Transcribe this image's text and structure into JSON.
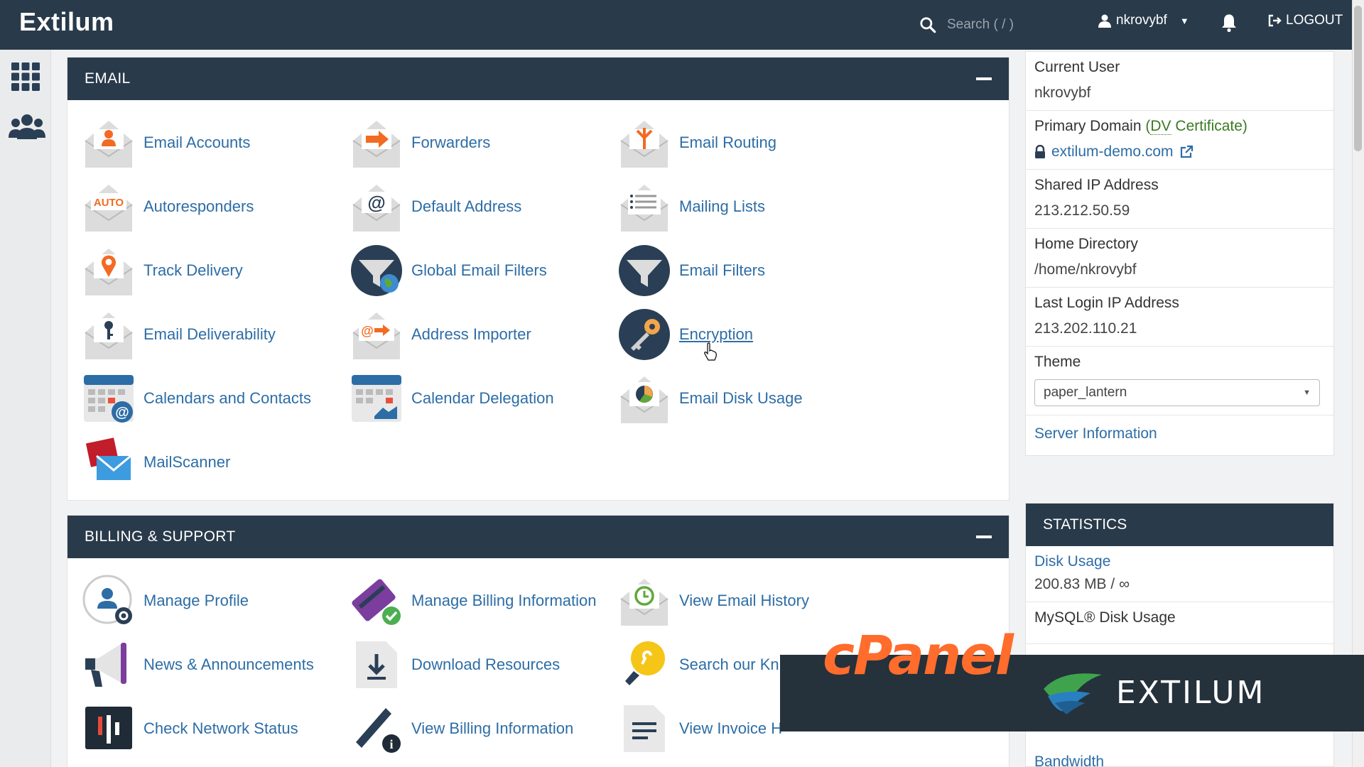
{
  "header": {
    "brand": "Extilum",
    "search_placeholder": "Search ( / )",
    "username": "nkrovybf",
    "logout_label": "LOGOUT"
  },
  "email_panel": {
    "title": "EMAIL",
    "items": [
      {
        "label": "Email Accounts",
        "icon": "email-accounts-icon"
      },
      {
        "label": "Forwarders",
        "icon": "forwarders-icon"
      },
      {
        "label": "Email Routing",
        "icon": "email-routing-icon"
      },
      {
        "label": "Autoresponders",
        "icon": "autoresponders-icon"
      },
      {
        "label": "Default Address",
        "icon": "default-address-icon"
      },
      {
        "label": "Mailing Lists",
        "icon": "mailing-lists-icon"
      },
      {
        "label": "Track Delivery",
        "icon": "track-delivery-icon"
      },
      {
        "label": "Global Email Filters",
        "icon": "global-email-filters-icon"
      },
      {
        "label": "Email Filters",
        "icon": "email-filters-icon"
      },
      {
        "label": "Email Deliverability",
        "icon": "email-deliverability-icon"
      },
      {
        "label": "Address Importer",
        "icon": "address-importer-icon"
      },
      {
        "label": "Encryption",
        "icon": "encryption-icon"
      },
      {
        "label": "Calendars and Contacts",
        "icon": "calendars-contacts-icon"
      },
      {
        "label": "Calendar Delegation",
        "icon": "calendar-delegation-icon"
      },
      {
        "label": "Email Disk Usage",
        "icon": "email-disk-usage-icon"
      },
      {
        "label": "MailScanner",
        "icon": "mailscanner-icon"
      }
    ],
    "auto_badge": "AUTO"
  },
  "billing_panel": {
    "title": "BILLING & SUPPORT",
    "items": [
      {
        "label": "Manage Profile",
        "icon": "manage-profile-icon"
      },
      {
        "label": "Manage Billing Information",
        "icon": "manage-billing-icon"
      },
      {
        "label": "View Email History",
        "icon": "view-email-history-icon"
      },
      {
        "label": "News & Announcements",
        "icon": "news-icon"
      },
      {
        "label": "Download Resources",
        "icon": "download-resources-icon"
      },
      {
        "label": "Search our Kn",
        "icon": "knowledge-base-icon"
      },
      {
        "label": "Check Network Status",
        "icon": "network-status-icon"
      },
      {
        "label": "View Billing Information",
        "icon": "view-billing-icon"
      },
      {
        "label": "View Invoice H",
        "icon": "view-invoice-icon"
      }
    ]
  },
  "general_info": {
    "current_user_label": "Current User",
    "current_user": "nkrovybf",
    "primary_domain_label": "Primary Domain",
    "primary_domain_open": "(",
    "dv_label": "DV",
    "certificate_label": " Certificate)",
    "domain": "extilum-demo.com",
    "shared_ip_label": "Shared IP Address",
    "shared_ip": "213.212.50.59",
    "home_dir_label": "Home Directory",
    "home_dir": "/home/nkrovybf",
    "last_login_label": "Last Login IP Address",
    "last_login_ip": "213.202.110.21",
    "theme_label": "Theme",
    "theme_value": "paper_lantern",
    "server_info_link": "Server Information"
  },
  "statistics": {
    "title": "STATISTICS",
    "disk_usage_label": "Disk Usage",
    "disk_usage_value": "200.83 MB / ∞",
    "mysql_label": "MySQL® Disk Usage",
    "bandwidth_label": "Bandwidth"
  },
  "overlay": {
    "cpanel_text": "cPanel",
    "extilum_text": "EXTILUM"
  },
  "colors": {
    "navy": "#293a4a",
    "link": "#2d6da6",
    "accent_orange": "#ff6c2c"
  }
}
